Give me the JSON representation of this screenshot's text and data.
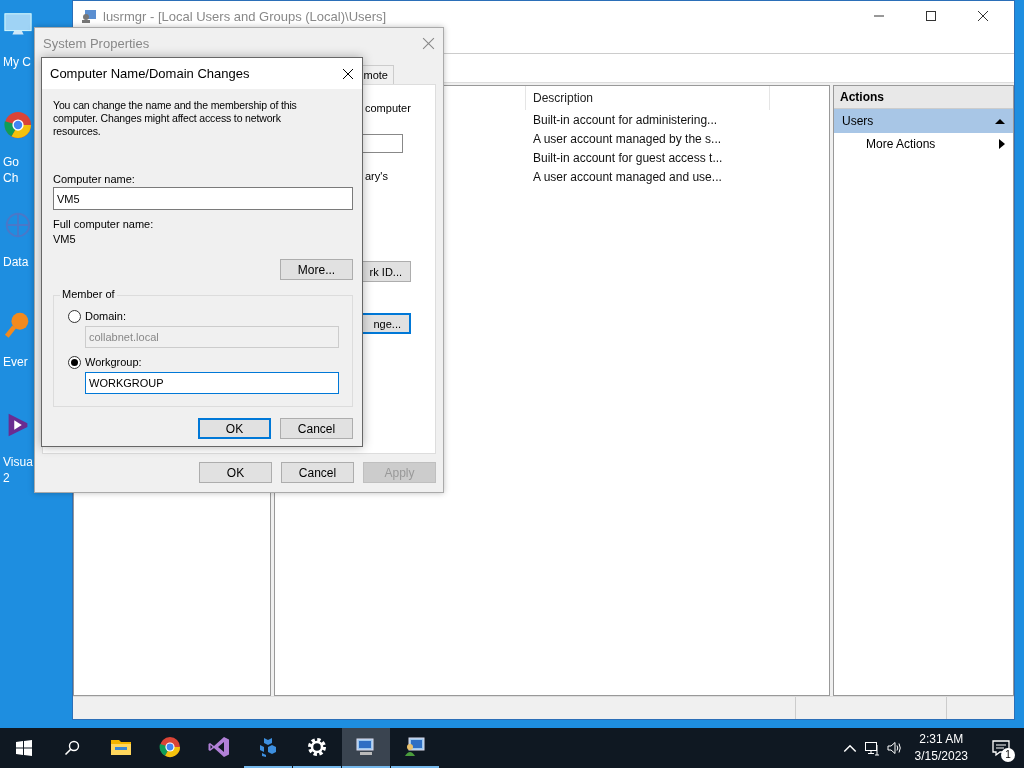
{
  "desktop": {
    "icons": [
      {
        "kind": "computer",
        "lines": [
          "My C"
        ]
      },
      {
        "kind": "chrome",
        "lines": [
          "Go",
          "Ch"
        ]
      },
      {
        "kind": "network",
        "lines": [
          "Data"
        ]
      },
      {
        "kind": "search",
        "lines": [
          "Ever"
        ]
      },
      {
        "kind": "studio",
        "lines": [
          "Visua",
          "2"
        ]
      }
    ]
  },
  "lusrmgr": {
    "title": "lusrmgr - [Local Users and Groups (Local)\\Users]",
    "active": false,
    "column": "Description",
    "rows": [
      {
        "description": "Built-in account for administering..."
      },
      {
        "description": "A user account managed by the s..."
      },
      {
        "description": "Built-in account for guest access t..."
      },
      {
        "description": "A user account managed and use..."
      }
    ],
    "actions": {
      "title": "Actions",
      "section": {
        "label": "Users",
        "expanded": true
      },
      "items": [
        {
          "label": "More Actions"
        }
      ]
    }
  },
  "system_properties": {
    "title": "System Properties",
    "active": false,
    "tab": {
      "label": "mote",
      "selected": false
    },
    "content": [
      {
        "kind": "text",
        "text": "computer"
      },
      {
        "kind": "field"
      },
      {
        "kind": "text",
        "text": "ary's"
      },
      {
        "kind": "button",
        "text": "rk ID...",
        "focused": false
      },
      {
        "kind": "button",
        "text": "nge...",
        "focused": true
      }
    ],
    "buttons": [
      {
        "label": "OK",
        "disabled": false
      },
      {
        "label": "Cancel",
        "disabled": false
      },
      {
        "label": "Apply",
        "disabled": true
      }
    ]
  },
  "dialog": {
    "title": "Computer Name/Domain Changes",
    "intro": "You can change the name and the membership of this computer. Changes might affect access to network resources.",
    "computer_name": {
      "label": "Computer name:",
      "value": "VM5"
    },
    "full_name": {
      "label": "Full computer name:",
      "value": "VM5"
    },
    "more_button": "More...",
    "member_of": {
      "legend": "Member of",
      "options": [
        {
          "label": "Domain:",
          "selected": false,
          "value": "collabnet.local",
          "disabled": true,
          "focused": false
        },
        {
          "label": "Workgroup:",
          "selected": true,
          "value": "WORKGROUP",
          "disabled": false,
          "focused": true
        }
      ]
    },
    "buttons": [
      {
        "label": "OK",
        "default": true
      },
      {
        "label": "Cancel",
        "default": false
      }
    ]
  },
  "taskbar": {
    "apps": [
      {
        "kind": "explorer",
        "running": false,
        "active": false
      },
      {
        "kind": "chrome",
        "running": false,
        "active": false
      },
      {
        "kind": "studio",
        "running": false,
        "active": false
      },
      {
        "kind": "network",
        "running": true,
        "active": false
      },
      {
        "kind": "gear",
        "running": true,
        "active": false
      },
      {
        "kind": "monitor",
        "running": true,
        "active": true
      },
      {
        "kind": "users",
        "running": true,
        "active": false
      }
    ],
    "time": "2:31 AM",
    "date": "3/15/2023",
    "notifications": "1"
  }
}
